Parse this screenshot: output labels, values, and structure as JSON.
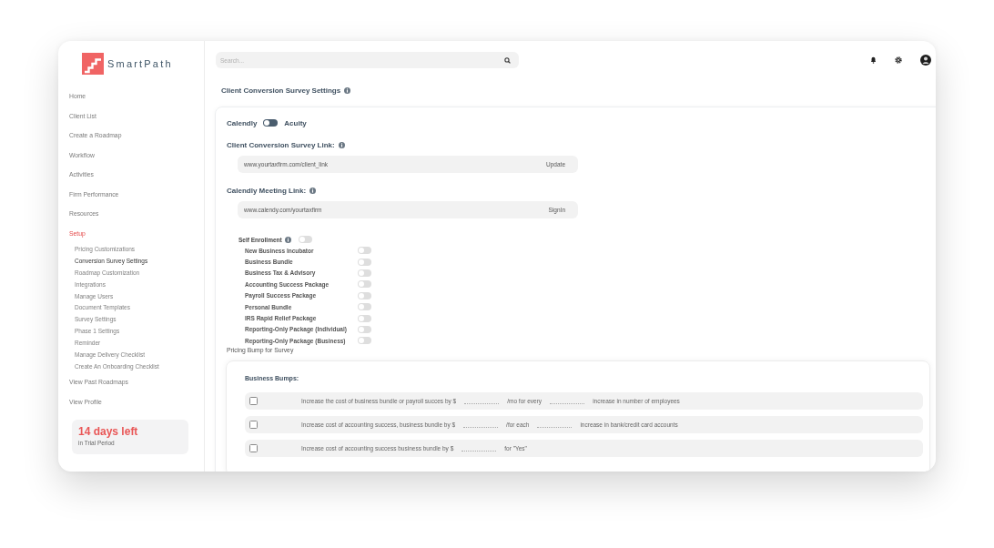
{
  "sidebar": {
    "logo_text": "SmartPath",
    "nav": [
      {
        "label": "Home",
        "selected": false
      },
      {
        "label": "Client List",
        "selected": false
      },
      {
        "label": "Create a Roadmap",
        "selected": false
      },
      {
        "label": "Workflow",
        "selected": false
      },
      {
        "label": "Activities",
        "selected": false
      },
      {
        "label": "Firm Performance",
        "selected": false
      },
      {
        "label": "Resources",
        "selected": false
      },
      {
        "label": "Setup",
        "selected": true,
        "children": [
          {
            "label": "Pricing Customizations",
            "selected": false
          },
          {
            "label": "Conversion Survey Settings",
            "selected": true
          },
          {
            "label": "Roadmap Customization",
            "selected": false
          },
          {
            "label": "Integrations",
            "selected": false
          },
          {
            "label": "Manage Users",
            "selected": false
          },
          {
            "label": "Document Templates",
            "selected": false
          },
          {
            "label": "Survey Settings",
            "selected": false
          },
          {
            "label": "Phase 1 Settings",
            "selected": false
          },
          {
            "label": "Reminder",
            "selected": false
          },
          {
            "label": "Manage Delivery Checklist",
            "selected": false
          },
          {
            "label": "Create An Onboarding Checklist",
            "selected": false
          }
        ]
      },
      {
        "label": "View Past Roadmaps",
        "selected": false
      },
      {
        "label": "View Profile",
        "selected": false
      }
    ],
    "trial": {
      "days": "14 days left",
      "caption": "in Trial Period"
    }
  },
  "topbar": {
    "search": {
      "placeholder": "Search..."
    }
  },
  "page": {
    "title": "Client Conversion Survey Settings"
  },
  "scheduler_switch": {
    "left_label": "Calendly",
    "right_label": "Acuity",
    "on": false
  },
  "survey_link": {
    "label": "Client Conversion Survey Link:",
    "value": "www.yourtaxfirm.com/client_link",
    "action": "Update"
  },
  "meeting_link": {
    "label": "Calendly Meeting Link:",
    "value": "www.calendy.com/yourtaxfirm",
    "action": "SignIn"
  },
  "self_enrollment": {
    "label": "Self Enrollment",
    "on": false,
    "packages": [
      {
        "name": "New Business Incubator",
        "on": false
      },
      {
        "name": "Business Bundle",
        "on": false
      },
      {
        "name": "Business Tax & Advisory",
        "on": false
      },
      {
        "name": "Accounting Success Package",
        "on": false
      },
      {
        "name": "Payroll Success Package",
        "on": false
      },
      {
        "name": "Personal Bundle",
        "on": false
      },
      {
        "name": "IRS Rapid Relief Package",
        "on": false
      },
      {
        "name": "Reporting-Only Package (Individual)",
        "on": false
      },
      {
        "name": "Reporting-Only Package (Business)",
        "on": false
      }
    ]
  },
  "pricing_bump": {
    "title": "Pricing Bump for Survey",
    "section": "Business Bumps:",
    "rows": [
      {
        "checked": false,
        "parts": [
          {
            "kind": "text",
            "text": "Increase the cost of business bundle or payroll succes by $"
          },
          {
            "kind": "blank"
          },
          {
            "kind": "text",
            "text": "/mo for every"
          },
          {
            "kind": "blank"
          },
          {
            "kind": "text",
            "text": "increase in number of employees"
          }
        ]
      },
      {
        "checked": false,
        "parts": [
          {
            "kind": "text",
            "text": "Increase cost of accounting success, business bundle by $"
          },
          {
            "kind": "blank"
          },
          {
            "kind": "text",
            "text": "/for each"
          },
          {
            "kind": "blank"
          },
          {
            "kind": "text",
            "text": "increase in bank/credit card accounts"
          }
        ]
      },
      {
        "checked": false,
        "parts": [
          {
            "kind": "text",
            "text": "Increase cost of accounting success business bundle by $"
          },
          {
            "kind": "blank"
          },
          {
            "kind": "text",
            "text": "for \"Yes\""
          }
        ]
      }
    ]
  }
}
